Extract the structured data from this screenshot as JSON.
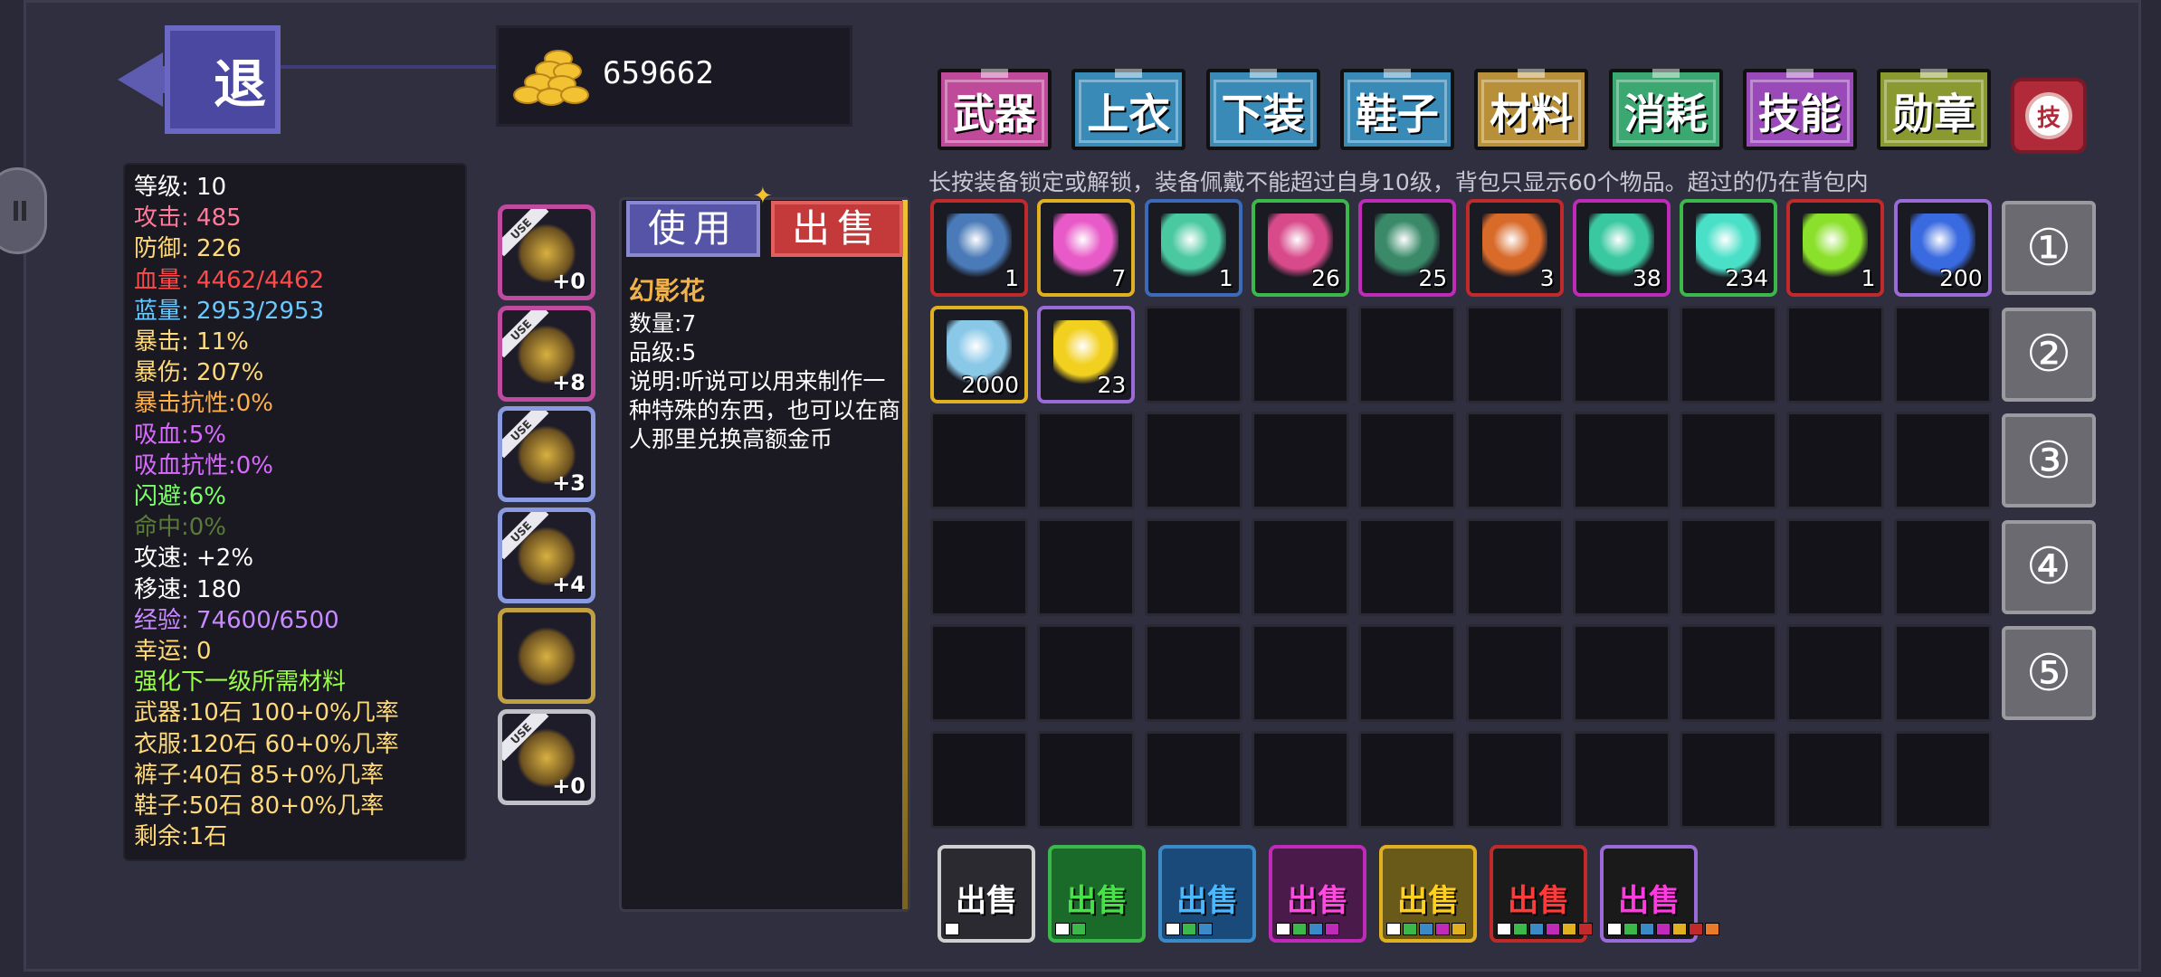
{
  "back": {
    "label": "退"
  },
  "gold": {
    "amount": "659662"
  },
  "stats": [
    {
      "text": "等级: 10",
      "color": "#ffffff"
    },
    {
      "text": "攻击: 485",
      "color": "#ff7a9a"
    },
    {
      "text": "防御: 226",
      "color": "#ffd97a"
    },
    {
      "text": "血量: 4462/4462",
      "color": "#ff4a4a"
    },
    {
      "text": "蓝量: 2953/2953",
      "color": "#6ac8ff"
    },
    {
      "text": "暴击: 11%",
      "color": "#ffd97a"
    },
    {
      "text": "暴伤: 207%",
      "color": "#ffd97a"
    },
    {
      "text": "暴击抗性:0%",
      "color": "#ffb04a"
    },
    {
      "text": "吸血:5%",
      "color": "#d86aff"
    },
    {
      "text": "吸血抗性:0%",
      "color": "#d86aff"
    },
    {
      "text": "闪避:6%",
      "color": "#7aff6a"
    },
    {
      "text": "命中:0%",
      "color": "#5a7a3a"
    },
    {
      "text": "攻速: +2%",
      "color": "#ffffff"
    },
    {
      "text": "移速: 180",
      "color": "#ffffff"
    },
    {
      "text": "经验: 74600/6500",
      "color": "#c88aff"
    },
    {
      "text": "幸运: 0",
      "color": "#ffd97a"
    },
    {
      "text": "强化下一级所需材料",
      "color": "#9aff4a"
    },
    {
      "text": "武器:10石 100+0%几率",
      "color": "#ffd97a"
    },
    {
      "text": "衣服:120石 60+0%几率",
      "color": "#ffd97a"
    },
    {
      "text": "裤子:40石 85+0%几率",
      "color": "#ffd97a"
    },
    {
      "text": "鞋子:50石 80+0%几率",
      "color": "#ffd97a"
    },
    {
      "text": "剩余:1石",
      "color": "#ffd97a"
    }
  ],
  "equipped": [
    {
      "name": "weapon",
      "badge": "USE",
      "level": "+0",
      "border": "#c04aa0"
    },
    {
      "name": "armor",
      "badge": "USE",
      "level": "+8",
      "border": "#c04aa0"
    },
    {
      "name": "pants",
      "badge": "USE",
      "level": "+3",
      "border": "#8a9ae0"
    },
    {
      "name": "boots",
      "badge": "USE",
      "level": "+4",
      "border": "#8a9ae0"
    },
    {
      "name": "wings",
      "badge": "",
      "level": "",
      "border": "#c0a040"
    },
    {
      "name": "skill",
      "badge": "USE",
      "level": "+0",
      "border": "#c0c0c8"
    }
  ],
  "detail": {
    "use_label": "使用",
    "sell_label": "出售",
    "item_name": "幻影花",
    "quantity": "数量:7",
    "grade": "品级:5",
    "description": "说明:听说可以用来制作一种特殊的东西，也可以在商人那里兑换高额金币"
  },
  "tabs": [
    {
      "label": "武器",
      "bg": "#c04a9a"
    },
    {
      "label": "上衣",
      "bg": "#3a8ab8"
    },
    {
      "label": "下装",
      "bg": "#3a8ab8"
    },
    {
      "label": "鞋子",
      "bg": "#3a8ab8"
    },
    {
      "label": "材料",
      "bg": "#b8903a"
    },
    {
      "label": "消耗",
      "bg": "#3aa870"
    },
    {
      "label": "技能",
      "bg": "#9a4ab8"
    },
    {
      "label": "勋章",
      "bg": "#8a9a30"
    }
  ],
  "reset": {
    "label": "技"
  },
  "hint": "长按装备锁定或解锁，装备佩戴不能超过自身10级，背包只显示60个物品。超过的仍在背包内",
  "inventory": [
    {
      "icon": "book-icon",
      "count": "1",
      "border": "#c02a2a",
      "color": "#4a7ab8"
    },
    {
      "icon": "rainbow-flower-icon",
      "count": "7",
      "border": "#e0b020",
      "color": "#e85ac8"
    },
    {
      "icon": "crystal-icon",
      "count": "1",
      "border": "#3a6ab8",
      "color": "#4ac8a0"
    },
    {
      "icon": "key-icon",
      "count": "26",
      "border": "#3ab84a",
      "color": "#d84a8a"
    },
    {
      "icon": "potion-icon",
      "count": "25",
      "border": "#c02ab8",
      "color": "#3a8a6a"
    },
    {
      "icon": "demon-mask-icon",
      "count": "3",
      "border": "#c02a2a",
      "color": "#d86a2a"
    },
    {
      "icon": "slug-icon",
      "count": "38",
      "border": "#c02ab8",
      "color": "#3ac8a0"
    },
    {
      "icon": "shard-burst-icon",
      "count": "234",
      "border": "#3ab84a",
      "color": "#4ae0c8"
    },
    {
      "icon": "green-orb-icon",
      "count": "1",
      "border": "#c02a2a",
      "color": "#8ae02a"
    },
    {
      "icon": "blue-ore-icon",
      "count": "200",
      "border": "#9a6ad8",
      "color": "#3a6ae0"
    },
    {
      "icon": "ice-stone-icon",
      "count": "2000",
      "border": "#e0b020",
      "color": "#8ac8e8"
    },
    {
      "icon": "star-icon",
      "count": "23",
      "border": "#9a6ad8",
      "color": "#f2d020"
    }
  ],
  "pages": [
    "①",
    "②",
    "③",
    "④",
    "⑤"
  ],
  "bulk_sell": [
    {
      "label": "出售",
      "bg": "#2a2a30",
      "border": "#d0d0d0",
      "text": "#ffffff",
      "dots": [
        "#ffffff"
      ]
    },
    {
      "label": "出售",
      "bg": "#1a6a2a",
      "border": "#3ab84a",
      "text": "#4ae04a",
      "dots": [
        "#ffffff",
        "#3ab84a"
      ]
    },
    {
      "label": "出售",
      "bg": "#1a4a7a",
      "border": "#3a8ac8",
      "text": "#4ab8ff",
      "dots": [
        "#ffffff",
        "#3ab84a",
        "#3a8ac8"
      ]
    },
    {
      "label": "出售",
      "bg": "#4a1a4a",
      "border": "#c02ab8",
      "text": "#ff4ae0",
      "dots": [
        "#ffffff",
        "#3ab84a",
        "#3a8ac8",
        "#c02ab8"
      ]
    },
    {
      "label": "出售",
      "bg": "#6a5a1a",
      "border": "#e0b020",
      "text": "#ffd020",
      "dots": [
        "#ffffff",
        "#3ab84a",
        "#3a8ac8",
        "#c02ab8",
        "#e0b020"
      ]
    },
    {
      "label": "出售",
      "bg": "#1a1a1a",
      "border": "#c02a2a",
      "text": "#ff3a3a",
      "dots": [
        "#ffffff",
        "#3ab84a",
        "#3a8ac8",
        "#c02ab8",
        "#e0b020",
        "#c02a2a"
      ]
    },
    {
      "label": "出售",
      "bg": "#1a1a1a",
      "border": "#9a6ad8",
      "text": "#ff3ae0",
      "dots": [
        "#ffffff",
        "#3ab84a",
        "#3a8ac8",
        "#c02ab8",
        "#e0b020",
        "#c02a2a",
        "#e87a2a"
      ]
    }
  ]
}
